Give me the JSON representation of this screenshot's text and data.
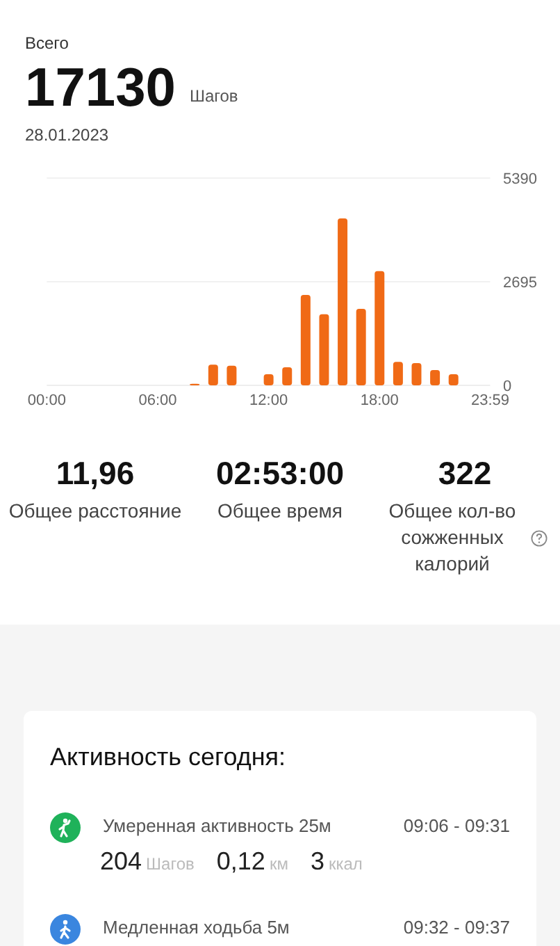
{
  "summary": {
    "label": "Всего",
    "steps": "17130",
    "unit": "Шагов",
    "date": "28.01.2023"
  },
  "chart_data": {
    "type": "bar",
    "x": [
      480,
      540,
      600,
      720,
      780,
      840,
      900,
      960,
      1020,
      1080,
      1140,
      1200,
      1260,
      1320
    ],
    "series": [
      {
        "color": "#f06a16",
        "values": [
          40,
          540,
          510,
          290,
          470,
          2350,
          1850,
          4340,
          1990,
          2970,
          610,
          580,
          400,
          290
        ]
      }
    ],
    "xlim": [
      0,
      1439
    ],
    "ylim": [
      0,
      5390
    ],
    "yticks": [
      0,
      2695,
      5390
    ],
    "xticks": [
      {
        "value": 0,
        "label": "00:00"
      },
      {
        "value": 360,
        "label": "06:00"
      },
      {
        "value": 720,
        "label": "12:00"
      },
      {
        "value": 1080,
        "label": "18:00"
      },
      {
        "value": 1439,
        "label": "23:59"
      }
    ]
  },
  "stats": [
    {
      "value": "11,96",
      "label": "Общее расстояние",
      "help": false
    },
    {
      "value": "02:53:00",
      "label": "Общее время",
      "help": false
    },
    {
      "value": "322",
      "label": "Общее кол-во сожженных калорий",
      "help": true
    }
  ],
  "activity": {
    "title": "Активность сегодня:",
    "items": [
      {
        "kind": "moderate",
        "color": "#1fb25a",
        "title": "Умеренная активность 25м",
        "time": "09:06 - 09:31",
        "metrics": [
          {
            "value": "204",
            "unit": "Шагов"
          },
          {
            "value": "0,12",
            "unit": "км"
          },
          {
            "value": "3",
            "unit": "ккал"
          }
        ]
      },
      {
        "kind": "slow",
        "color": "#3a86df",
        "title": "Медленная ходьба 5м",
        "time": "09:32 - 09:37"
      }
    ]
  }
}
